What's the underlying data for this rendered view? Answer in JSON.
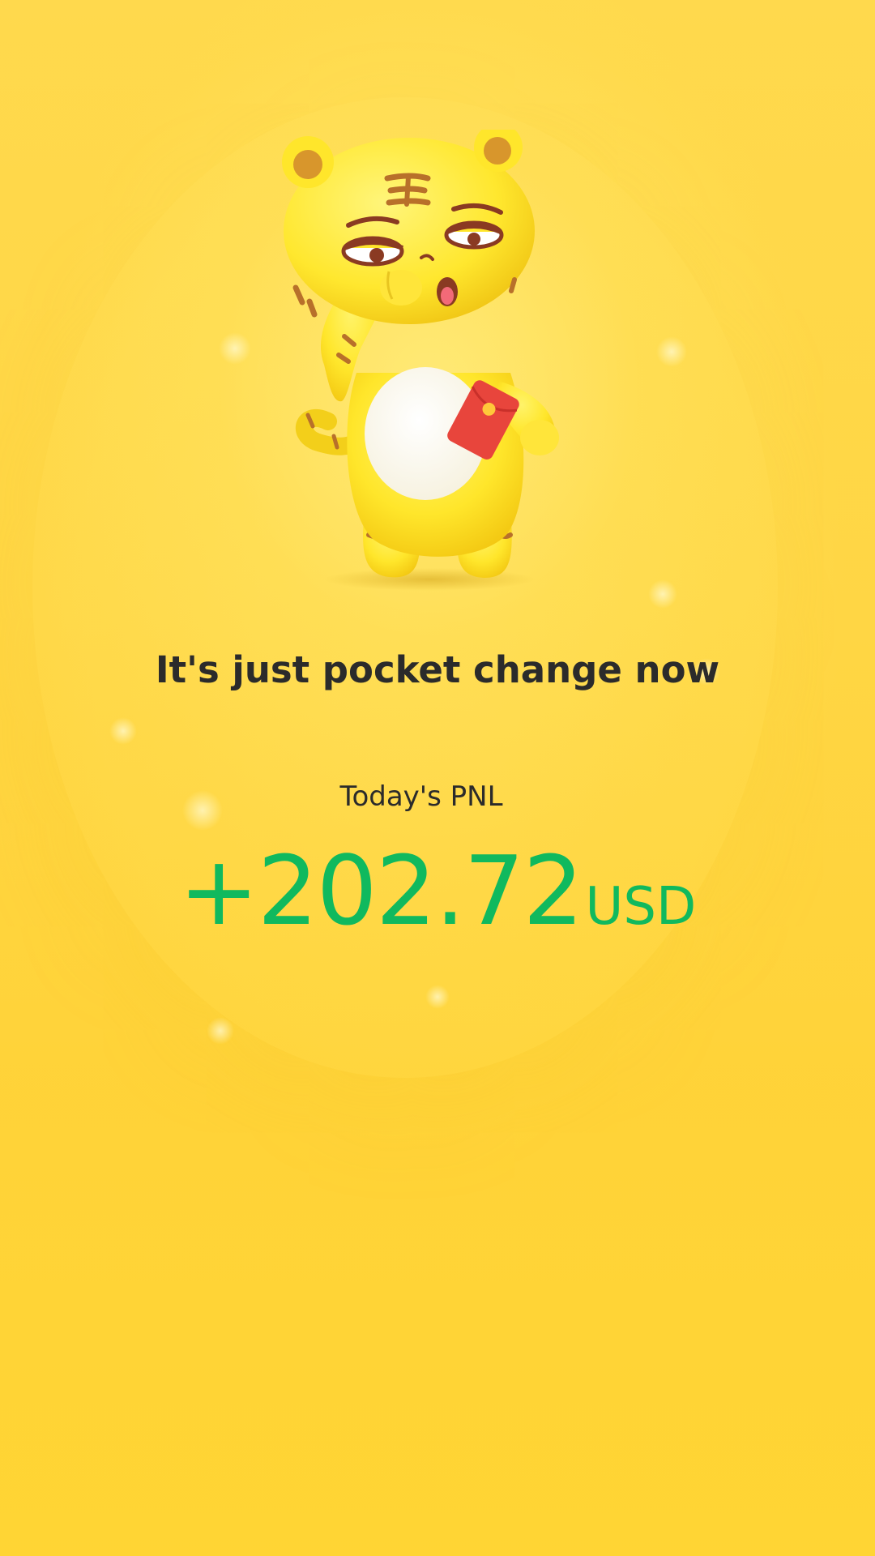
{
  "screen": {
    "headline": "It's just pocket change now",
    "pnl_label": "Today's PNL",
    "pnl_amount": "+202.72",
    "pnl_unit": "USD"
  },
  "mascot": {
    "icon": "tiger-mascot-yawning-holding-red-envelope",
    "accessory_icon": "red-envelope-icon"
  },
  "colors": {
    "background": "#ffd94a",
    "headline_text": "#2b2b2b",
    "pnl_positive": "#10b95e",
    "red_envelope": "#e8453c"
  }
}
